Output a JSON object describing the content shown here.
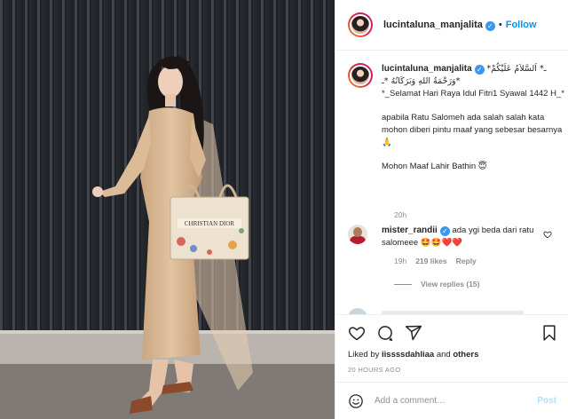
{
  "photo": {
    "bag_text": "CHRISTIAN DIOR",
    "colors": {
      "wall": "#2b2e33",
      "dress": "#d8b896",
      "ground": "#8a8580"
    }
  },
  "header": {
    "username": "lucintaluna_manjalita",
    "verified_icon": "verified-badge-icon",
    "separator": "•",
    "follow_label": "Follow"
  },
  "caption": {
    "username": "lucintaluna_manjalita",
    "line1": "*ـ* اَلسَّلاَمُ عَلَيْكُمْ وَرَحْمَةُ اللهِ وَبَرَكَاتُهُ *ـ*",
    "line2": "*_Selamat Hari Raya Idul Fitri1 Syawal 1442 H_*",
    "line3": "apabila Ratu Salomeh ada salah salah kata mohon diberi pintu maaf yang sebesar besarnya 🙏",
    "line4": "Mohon Maaf Lahir Bathin 😇",
    "time": "20h"
  },
  "comment": {
    "username": "mister_randii",
    "text": "ada ygi beda dari ratu salomeee 🤩🤩❤️❤️",
    "time": "19h",
    "likes": "219 likes",
    "reply_label": "Reply",
    "view_replies": "View replies (15)"
  },
  "actions": {
    "icons": [
      "heart-icon",
      "comment-icon",
      "share-icon",
      "bookmark-icon"
    ],
    "liked_prefix": "Liked by",
    "liked_user": "iissssdahliaa",
    "liked_and": "and",
    "liked_others": "others",
    "time_ago": "20 HOURS AGO"
  },
  "add_comment": {
    "placeholder": "Add a comment…",
    "post_label": "Post"
  },
  "colors": {
    "link": "#0095f6",
    "verified": "#3897f0",
    "post_disabled": "#b2dffc",
    "muted": "#8e8e8e"
  }
}
